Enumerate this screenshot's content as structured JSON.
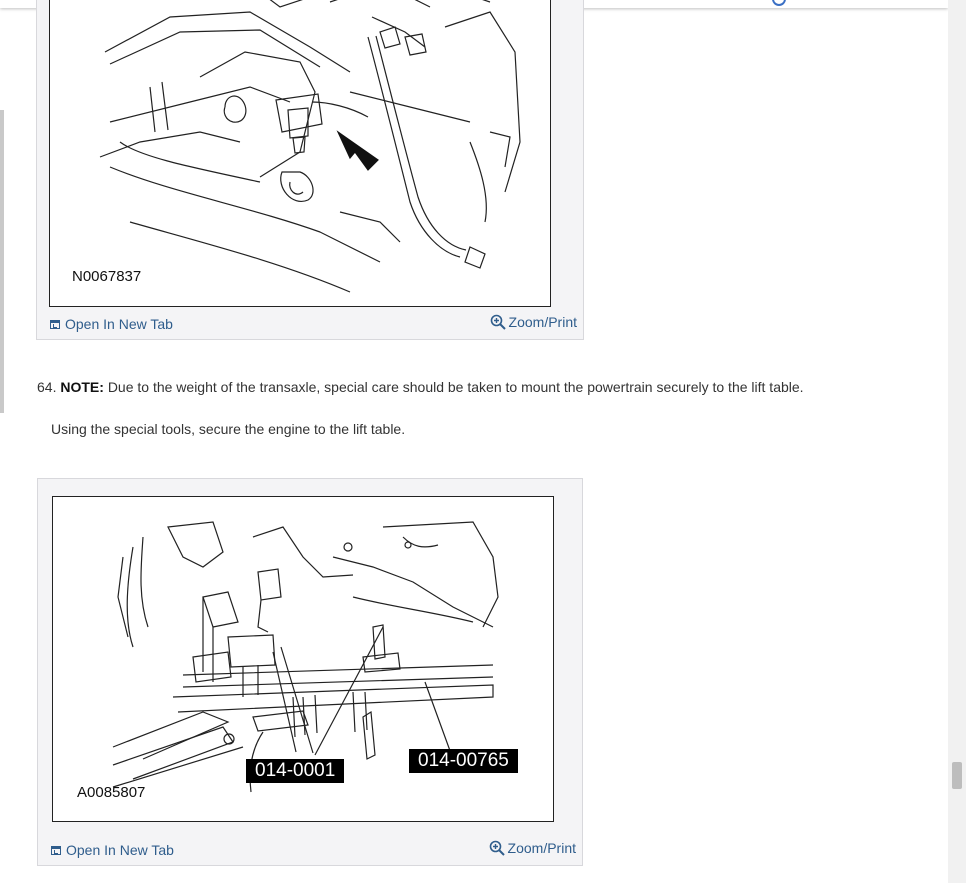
{
  "figures": [
    {
      "code": "N0067837",
      "open_tab": "Open In New Tab",
      "zoom": "Zoom/Print"
    },
    {
      "code": "A0085807",
      "labels": [
        "014-0001",
        "014-00765"
      ],
      "open_tab": "Open In New Tab",
      "zoom": "Zoom/Print"
    }
  ],
  "step": {
    "number": "64.",
    "note_label": "NOTE:",
    "note_text": "Due to the weight of the transaxle, special care should be taken to mount the powertrain securely to the lift table.",
    "instruction": "Using the special tools, secure the engine to the lift table."
  },
  "icons": {
    "open_tab": "open-new-tab-icon",
    "zoom": "magnifier-plus-icon"
  },
  "colors": {
    "link": "#2f5d8c",
    "text": "#333333"
  }
}
